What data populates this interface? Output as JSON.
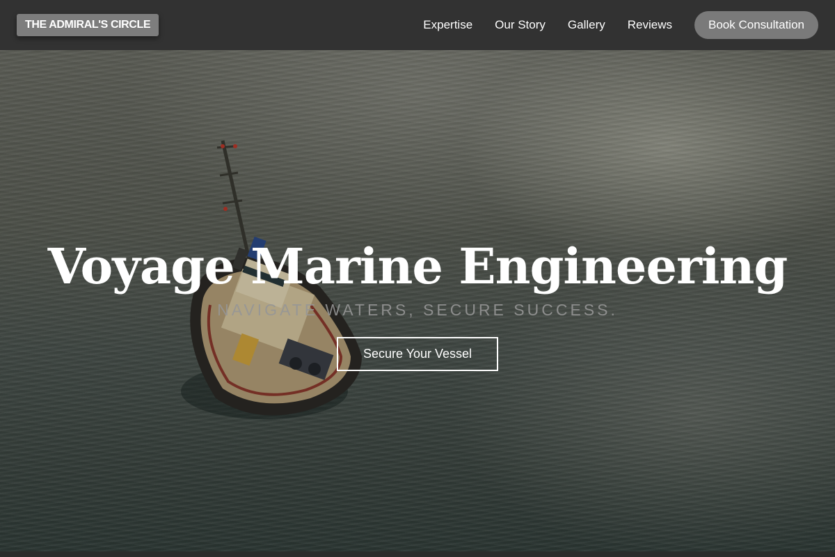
{
  "brand": {
    "name": "THE ADMIRAL'S CIRCLE"
  },
  "nav": {
    "links": [
      {
        "label": "Expertise"
      },
      {
        "label": "Our Story"
      },
      {
        "label": "Gallery"
      },
      {
        "label": "Reviews"
      }
    ],
    "cta_label": "Book Consultation"
  },
  "hero": {
    "title": "Voyage Marine Engineering",
    "subtitle": "NAVIGATE WATERS, SECURE SUCCESS.",
    "button_label": "Secure Your Vessel"
  },
  "colors": {
    "header_bg": "#323232",
    "logo_bg": "#7d7d7d",
    "cta_bg": "#7a7a7a",
    "text": "#ffffff"
  }
}
